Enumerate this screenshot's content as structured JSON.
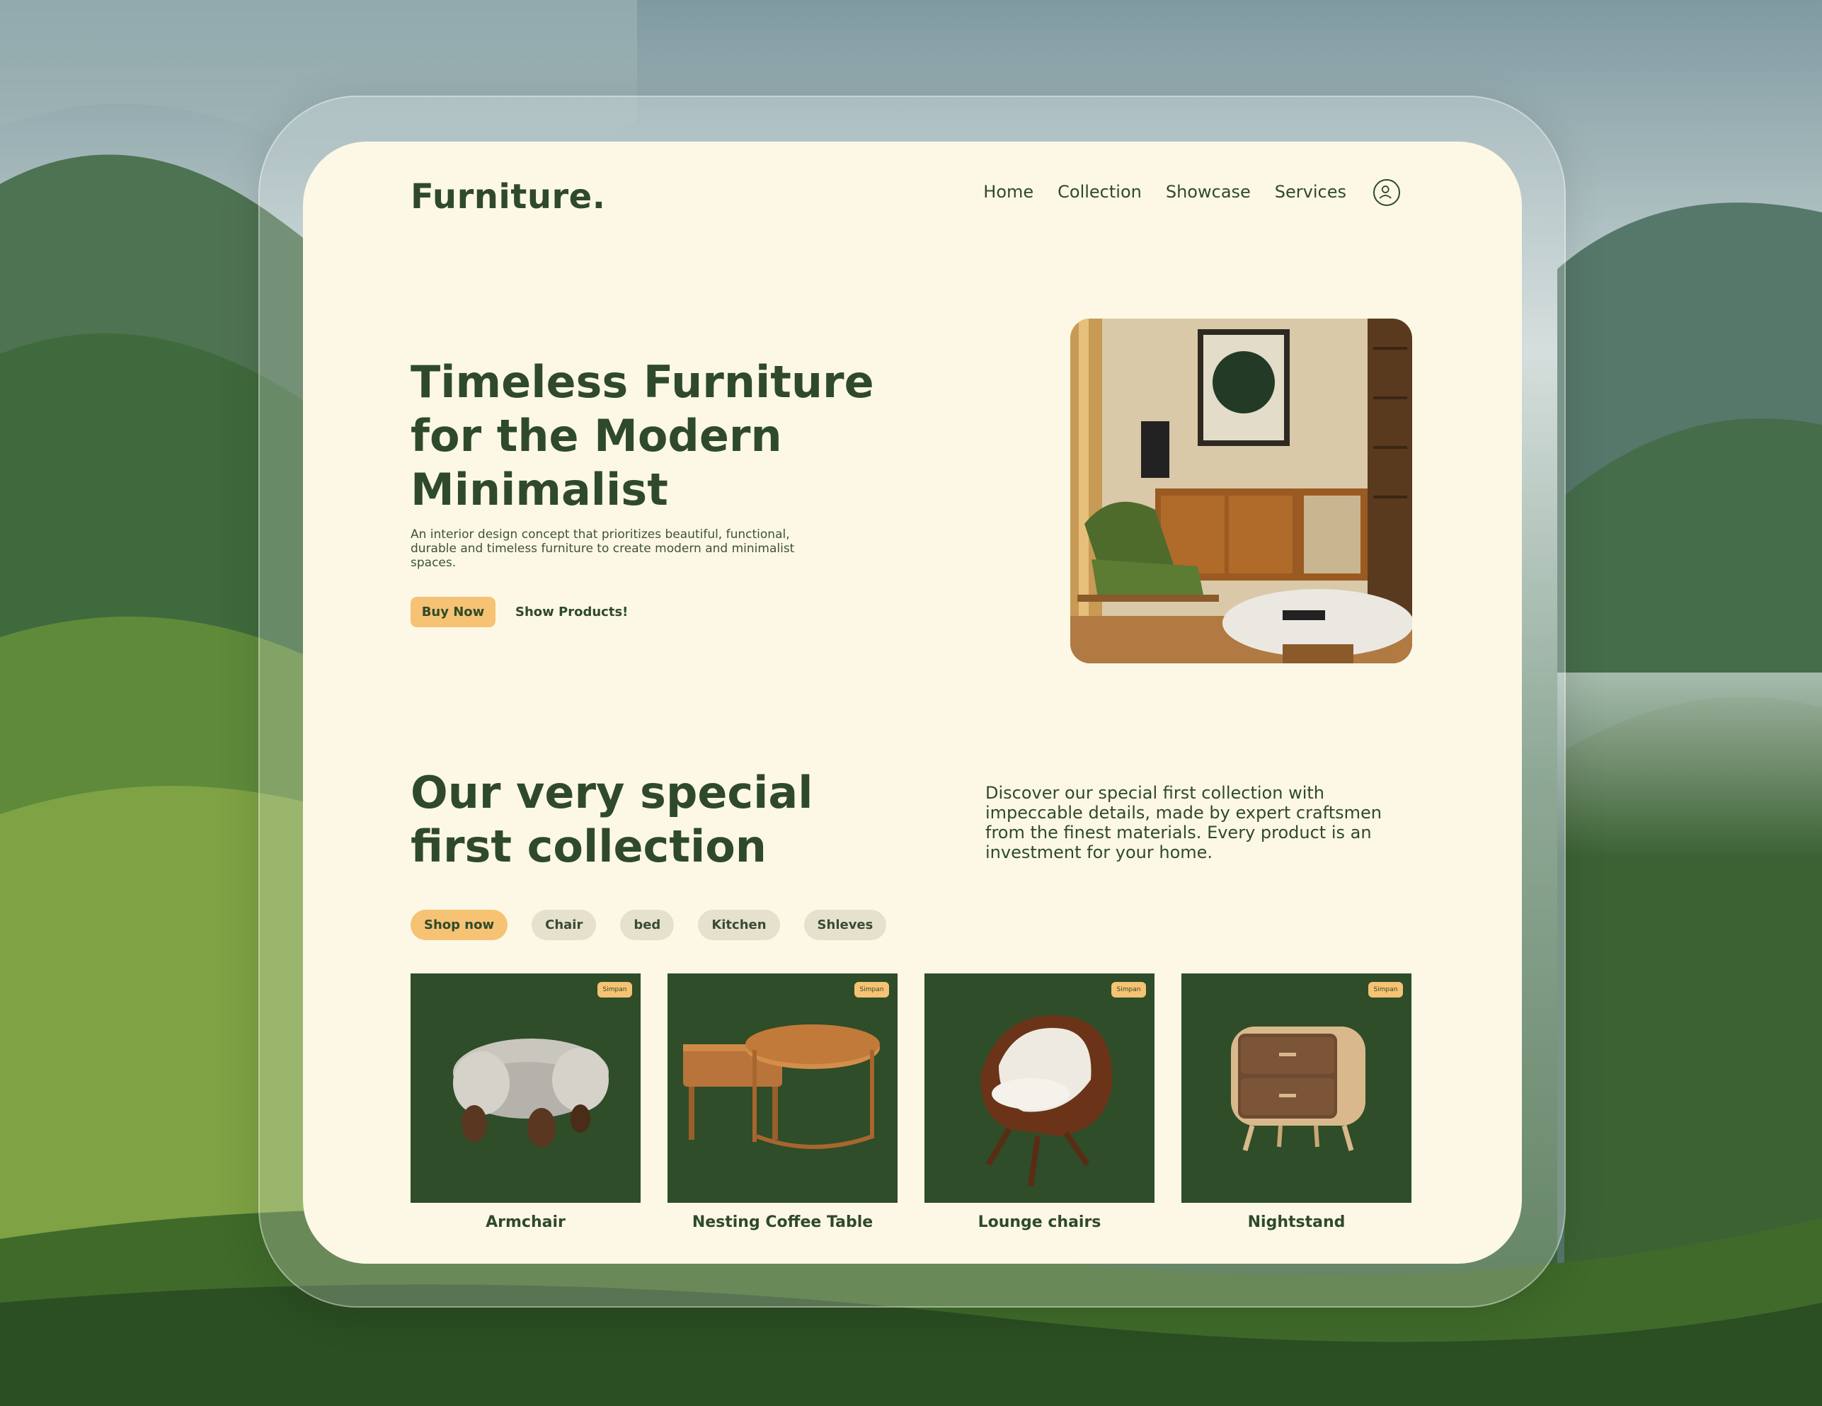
{
  "brand": "Furniture.",
  "nav": {
    "items": [
      "Home",
      "Collection",
      "Showcase",
      "Services"
    ]
  },
  "hero": {
    "title": "Timeless Furniture for the Modern Minimalist",
    "description": "An interior design concept that prioritizes beautiful, functional, durable and timeless furniture to create modern and minimalist spaces.",
    "buy_label": "Buy Now",
    "show_label": "Show Products!"
  },
  "collection": {
    "title": "Our very special first collection",
    "description": "Discover our special first collection with impeccable details, made by expert craftsmen from the finest materials. Every product is an investment for your home.",
    "chips": [
      {
        "label": "Shop now",
        "active": true
      },
      {
        "label": "Chair",
        "active": false
      },
      {
        "label": "bed",
        "active": false
      },
      {
        "label": "Kitchen",
        "active": false
      },
      {
        "label": "Shleves",
        "active": false
      }
    ]
  },
  "products": [
    {
      "name": "Armchair",
      "tag": "Simpan",
      "icon": "armchair-image"
    },
    {
      "name": "Nesting Coffee Table",
      "tag": "Simpan",
      "icon": "coffee-table-image"
    },
    {
      "name": "Lounge chairs",
      "tag": "Simpan",
      "icon": "lounge-chair-image"
    },
    {
      "name": "Nightstand",
      "tag": "Simpan",
      "icon": "nightstand-image"
    }
  ],
  "colors": {
    "card_bg": "#fdf8e6",
    "primary_green": "#2f4a2a",
    "accent_yellow": "#f6c274",
    "product_bg": "#2e4d28",
    "chip_bg": "#e6e1cd"
  }
}
